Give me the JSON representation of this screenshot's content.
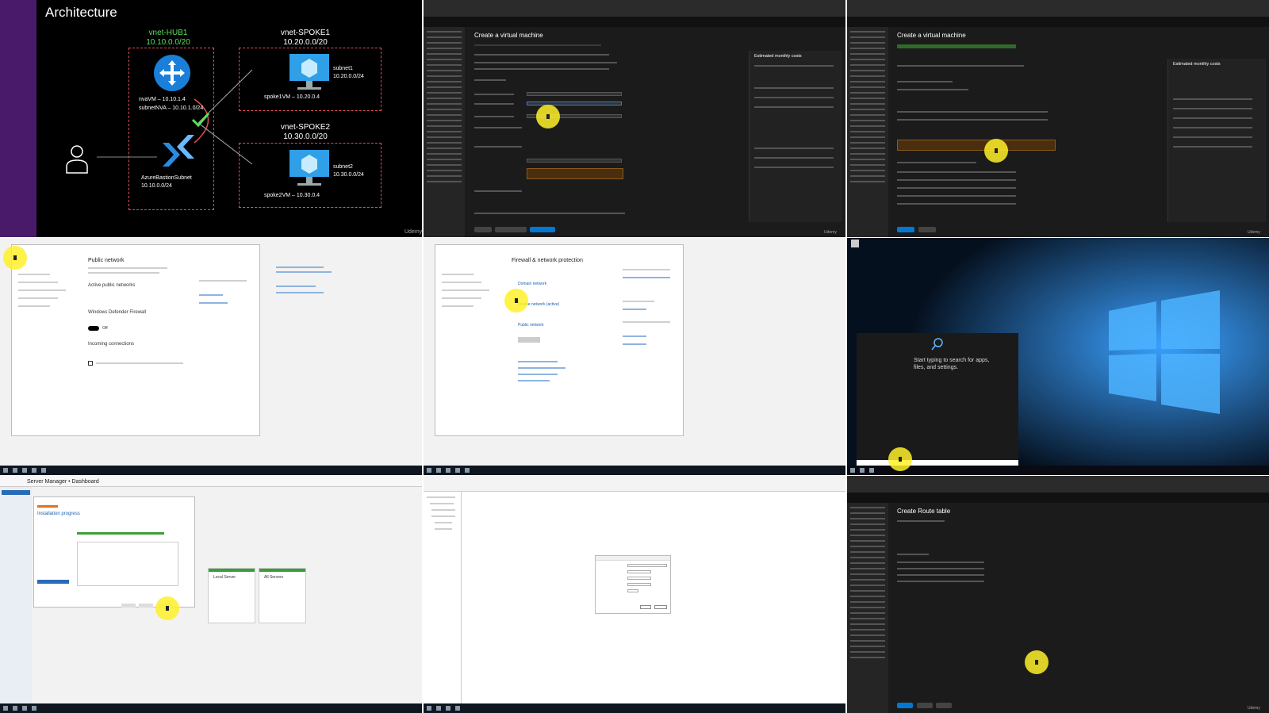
{
  "tile1": {
    "title": "Architecture",
    "hub": {
      "name": "vnet-HUB1",
      "cidr": "10.10.0.0/20"
    },
    "spoke1": {
      "name": "vnet-SPOKE1",
      "cidr": "10.20.0.0/20",
      "subnet": "subnet1",
      "subnet_cidr": "10.20.0.0/24",
      "vm": "spoke1VM – 10.20.0.4"
    },
    "spoke2": {
      "name": "vnet-SPOKE2",
      "cidr": "10.30.0.0/20",
      "subnet": "subnet2",
      "subnet_cidr": "10.30.0.0/24",
      "vm": "spoke2VM – 10.30.0.4"
    },
    "nva": {
      "vm": "nvaVM – 10.10.1.4",
      "subnet": "subnetNVA – 10.10.1.0/24"
    },
    "bastion": {
      "name": "AzureBastionSubnet",
      "cidr": "10.10.0.0/24"
    },
    "brand": "Udemy"
  },
  "tile2": {
    "page_title": "Create a virtual machine",
    "panel_title": "Estimated monthly costs",
    "brand": "Udemy"
  },
  "tile3": {
    "page_title": "Create a virtual machine",
    "panel_title": "Estimated monthly costs",
    "brand": "Udemy"
  },
  "tile4": {
    "title": "Public network",
    "section1": "Active public networks",
    "section2": "Windows Defender Firewall",
    "toggle_state": "Off",
    "section3": "Incoming connections"
  },
  "tile5": {
    "title": "Firewall & network protection",
    "domain": "Domain network",
    "private": "Private network (active)",
    "public": "Public network"
  },
  "tile6": {
    "search_hint": "Start typing to search for apps, files, and settings."
  },
  "tile7": {
    "title": "Server Manager • Dashboard",
    "wizard_title": "Installation progress",
    "tile_local": "Local Server",
    "tile_all": "All Servers"
  },
  "tile9": {
    "page_title": "Create Route table",
    "brand": "Udemy"
  },
  "colors": {
    "hub": "#58e05a",
    "spoke": "#ffffff",
    "dashed": "#e0505a",
    "accent": "#0078d4"
  }
}
